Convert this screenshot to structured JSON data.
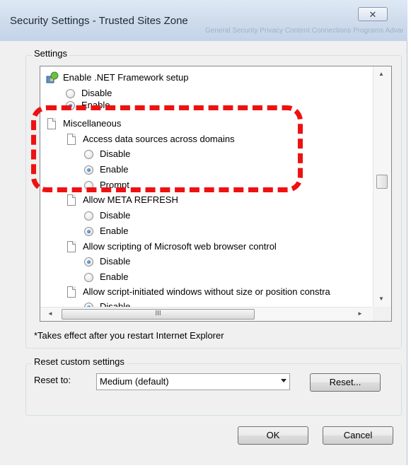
{
  "window": {
    "title": "Security Settings - Trusted Sites Zone",
    "close_glyph": "✕",
    "background_tabs": "General   Security   Privacy   Content   Connections   Programs   Advanced"
  },
  "settings_group": {
    "label": "Settings"
  },
  "settings_list": {
    "net_setup": {
      "label": "Enable .NET Framework setup",
      "opt_disable": "Disable",
      "opt_enable": "Enable",
      "selected": "Enable"
    },
    "misc_header": "Miscellaneous",
    "access_data": {
      "label": "Access data sources across domains",
      "opt_disable": "Disable",
      "opt_enable": "Enable",
      "opt_prompt": "Prompt",
      "selected": "Enable"
    },
    "meta_refresh": {
      "label": "Allow META REFRESH",
      "opt_disable": "Disable",
      "opt_enable": "Enable",
      "selected": "Enable"
    },
    "web_browser_ctrl": {
      "label": "Allow scripting of Microsoft web browser control",
      "opt_disable": "Disable",
      "opt_enable": "Enable",
      "selected": "Disable"
    },
    "script_windows": {
      "label": "Allow script-initiated windows without size or position constra",
      "opt_disable": "Disable",
      "selected": "Disable"
    }
  },
  "scrollbars": {
    "h_thumb_grip": "III",
    "left_arrow": "◄",
    "right_arrow": "►",
    "up_arrow": "▲",
    "down_arrow": "▼"
  },
  "note": "*Takes effect after you restart Internet Explorer",
  "reset_group": {
    "label": "Reset custom settings",
    "reset_to_label": "Reset to:",
    "selected_level": "Medium (default)",
    "reset_button": "Reset..."
  },
  "dialog_buttons": {
    "ok": "OK",
    "cancel": "Cancel"
  },
  "colors": {
    "highlight": "#ee1111",
    "accent": "#1c5aa8"
  },
  "icons": [
    "net-framework-icon",
    "page-icon",
    "radio-icon",
    "close-icon",
    "dropdown-arrow-icon"
  ]
}
